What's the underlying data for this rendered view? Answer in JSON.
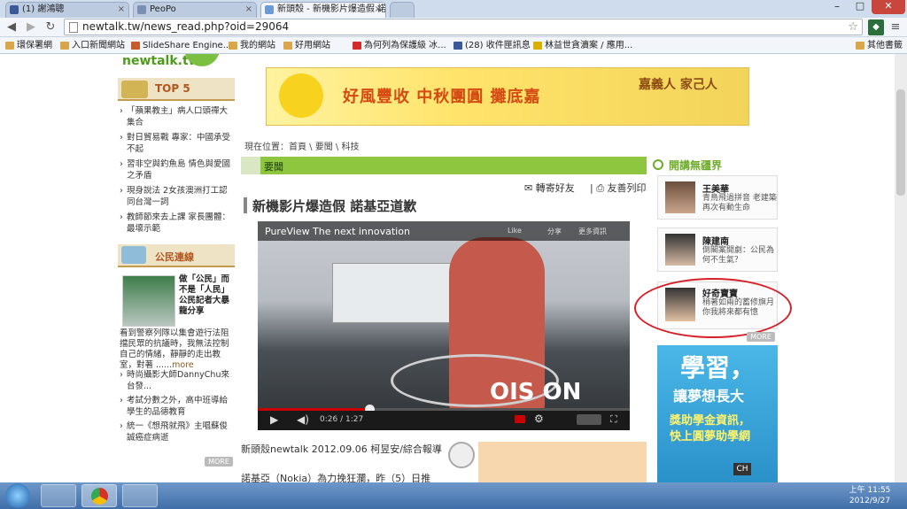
{
  "browser": {
    "tabs": [
      {
        "label": "(1) 謝鴻聰",
        "fav": "#3b5998"
      },
      {
        "label": "PeoPo",
        "fav": "#7a8fb1"
      },
      {
        "label": "新頭殼 - 新機影片爆造假 諾",
        "fav": "#6a9bd8"
      }
    ],
    "url": "newtalk.tw/news_read.php?oid=29064",
    "bookmarks": [
      {
        "label": "環保署網",
        "color": "#d9a64a"
      },
      {
        "label": "入口新聞網站",
        "color": "#d9a64a"
      },
      {
        "label": "SlideShare Engine...",
        "color": "#c65b2c"
      },
      {
        "label": "我的網站",
        "color": "#d9a64a"
      },
      {
        "label": "好用網站",
        "color": "#d9a64a"
      },
      {
        "label": "為何列為保護級 冰...",
        "color": "#d62b2b"
      },
      {
        "label": "(28) 收件匣訊息",
        "color": "#3b5998"
      },
      {
        "label": "林益世貪瀆案 / 應用...",
        "color": "#d9b000"
      },
      {
        "label": "其他書籤",
        "color": "#d9a64a"
      }
    ]
  },
  "site": {
    "logo": "newtalk.tw"
  },
  "sidebar": {
    "top5_title": "TOP 5",
    "top5": [
      "「蘋果教主」病人口頭禪大集合",
      "對日貿易戰 專家：中國承受不起",
      "習非空與釣魚島 情色與愛國之矛盾",
      "現身說法 2女孩澳洲打工認同台灣一詞",
      "教師節來去上課 家長團體：最壞示範"
    ],
    "citizen_title": "公民連線",
    "citizen_bold": "做「公民」而不是「人民」 公民記者大暴龍分享",
    "citizen_text": "看到警察列隊以集會遊行法阻擋民眾的抗議時，我無法控制自己的情緒，靜靜的走出教室，對著 ......",
    "citizen_more": "more",
    "citizen_items": [
      "時尚攝影大師DannyChu來台發...",
      "考試分數之外，高中班導給學生的品德教育",
      "統一《想飛就飛》主唱蘇俊誠癌症病逝"
    ],
    "more": "MORE"
  },
  "banner": {
    "text": "好風豐收 中秋團圓 攤底嘉",
    "side": "嘉義人 家己人"
  },
  "breadcrumb": "現在位置：首頁 \\ 要聞 \\ 科技",
  "section": "要聞",
  "tools": {
    "forward": "轉寄好友",
    "print": "友善列印"
  },
  "article": {
    "title": "新機影片爆造假 諾基亞道歉",
    "byline": "新頭殼newtalk 2012.09.06 柯昱安/綜合報導",
    "para": "諾基亞（Nokia）為力挽狂瀾，昨（5）日推"
  },
  "video": {
    "title": "PureView The next innovation",
    "like": "Like",
    "share": "分享",
    "more": "更多資訊",
    "overlay": "OIS ON",
    "time": "0:26 / 1:27",
    "progress": 0.3
  },
  "right": {
    "title": "開講無疆界",
    "items": [
      {
        "name": "王美華",
        "text": "青鳥飛過拼音 老建築再次有動生命"
      },
      {
        "name": "陳建南",
        "text": "倒閣案開劇：公民為何不生氣？"
      },
      {
        "name": "好奇寶寶",
        "text": "稍著如兩的蓄修旗月你我將來都有憶"
      }
    ],
    "more": "MORE",
    "ad_lines": [
      "學習，",
      "讓夢想長大",
      "獎助學金資訊，",
      "快上圓夢助學網"
    ]
  },
  "taskbar": {
    "ime": "CH",
    "time": "上午 11:55",
    "date": "2012/9/27"
  }
}
